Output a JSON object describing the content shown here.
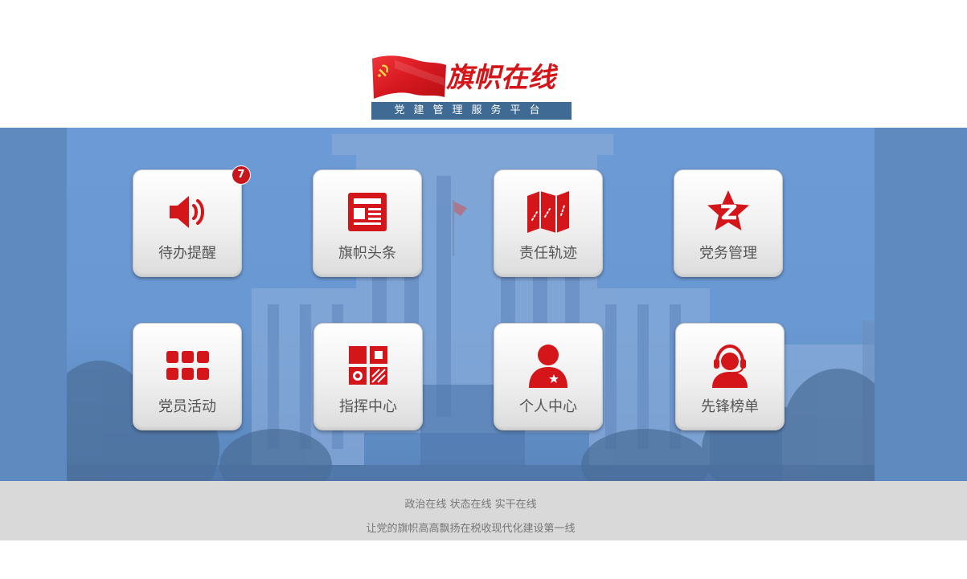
{
  "header": {
    "logo_title": "旗帜在线",
    "logo_subtitle": "党建管理服务平台"
  },
  "tiles": [
    {
      "label": "待办提醒",
      "icon": "speaker-icon",
      "badge": "7"
    },
    {
      "label": "旗帜头条",
      "icon": "newspaper-icon"
    },
    {
      "label": "责任轨迹",
      "icon": "map-icon"
    },
    {
      "label": "党务管理",
      "icon": "star-z-icon"
    },
    {
      "label": "党员活动",
      "icon": "grid-dots-icon"
    },
    {
      "label": "指挥中心",
      "icon": "command-grid-icon"
    },
    {
      "label": "个人中心",
      "icon": "person-icon"
    },
    {
      "label": "先锋榜单",
      "icon": "headset-icon"
    }
  ],
  "footer": {
    "line1": "政治在线 状态在线 实干在线",
    "line2": "让党的旗帜高高飘扬在税收现代化建设第一线"
  },
  "colors": {
    "accent_red": "#d4161b",
    "banner_blue": "#6b9ad6",
    "subtitle_bar": "#3e6a94",
    "footer_gray": "#d9d9d9"
  }
}
